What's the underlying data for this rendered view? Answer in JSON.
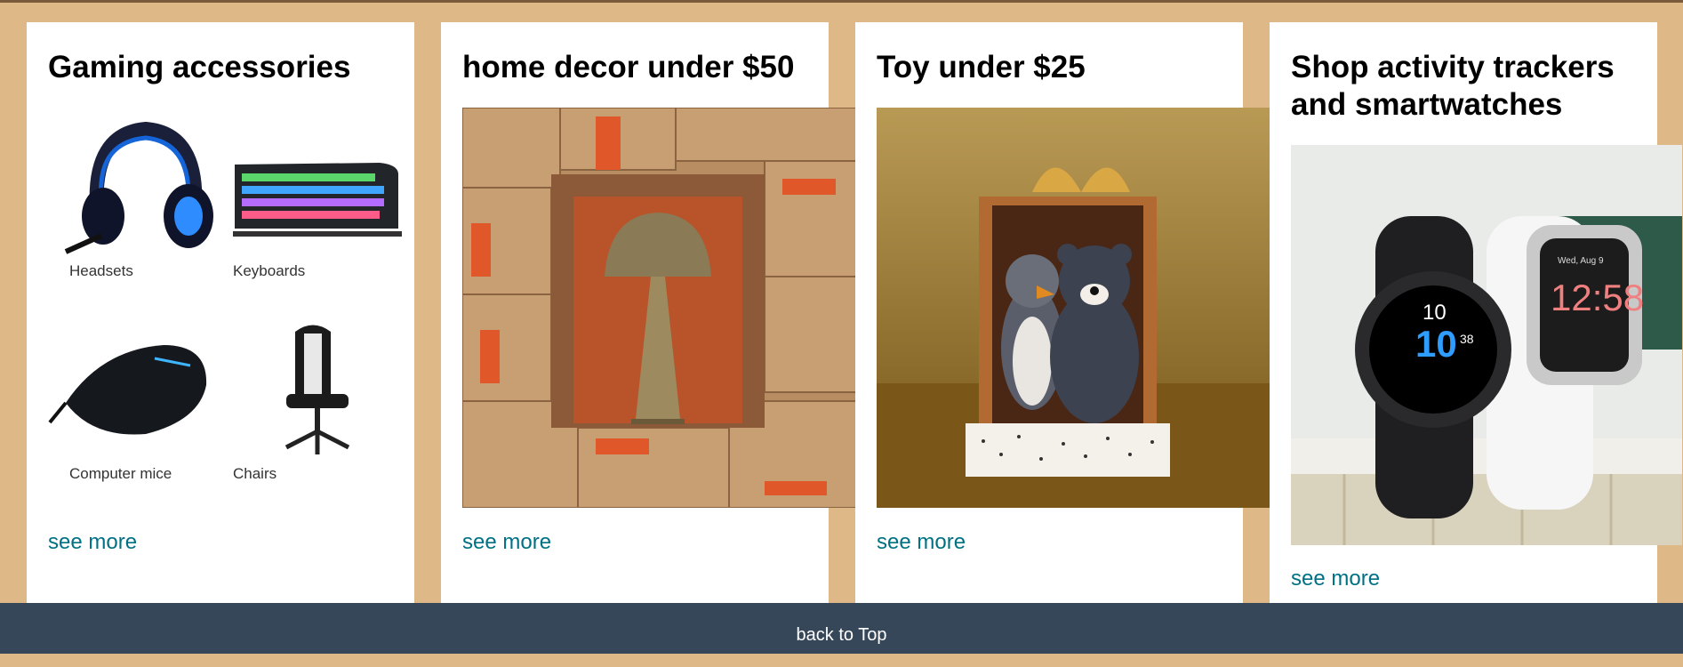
{
  "cards": [
    {
      "title": "Gaming accessories",
      "items": [
        {
          "label": "Headsets",
          "icon": "headset-icon"
        },
        {
          "label": "Keyboards",
          "icon": "keyboard-icon"
        },
        {
          "label": "Computer mice",
          "icon": "mouse-icon"
        },
        {
          "label": "Chairs",
          "icon": "gaming-chair-icon"
        }
      ],
      "link": "see more"
    },
    {
      "title": "home decor under $50",
      "image": "lamp-in-boxes-image",
      "link": "see more"
    },
    {
      "title": "Toy under $25",
      "image": "plush-toys-gift-box-image",
      "link": "see more"
    },
    {
      "title": "Shop activity trackers and smartwatches",
      "image": "smartwatches-image",
      "watch_time": "12:58",
      "watch_day": "Wed, Aug 9",
      "watch2_time": "10",
      "watch2_big": "10",
      "watch2_sec": "38",
      "link": "see more"
    }
  ],
  "footer": {
    "back_to_top": "back to Top"
  },
  "colors": {
    "background": "#deb887",
    "link": "#007185",
    "footer": "#37475a"
  }
}
